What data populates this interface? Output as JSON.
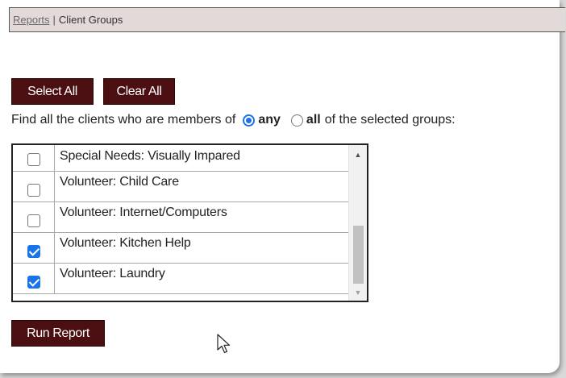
{
  "breadcrumb": {
    "link_label": "Reports",
    "separator": "|",
    "current": "Client Groups"
  },
  "buttons": {
    "select_all": "Select All",
    "clear_all": "Clear All",
    "run_report": "Run Report"
  },
  "match_mode": {
    "prefix": "Find all the clients who are members of",
    "option_any": "any",
    "option_all": "all",
    "suffix": "of the selected groups:",
    "selected": "any"
  },
  "groups": [
    {
      "label": "Special Needs: Visually Impared",
      "checked": false
    },
    {
      "label": "Volunteer: Child Care",
      "checked": false
    },
    {
      "label": "Volunteer: Internet/Computers",
      "checked": false
    },
    {
      "label": "Volunteer: Kitchen Help",
      "checked": true
    },
    {
      "label": "Volunteer: Laundry",
      "checked": true
    }
  ],
  "icons": {
    "scroll_up": "triangle-up-icon",
    "scroll_down": "triangle-down-icon",
    "cursor": "mouse-pointer-icon"
  },
  "colors": {
    "button_bg": "#4b0f12",
    "breadcrumb_bg": "#e3d9d8",
    "accent": "#1a73e8"
  }
}
